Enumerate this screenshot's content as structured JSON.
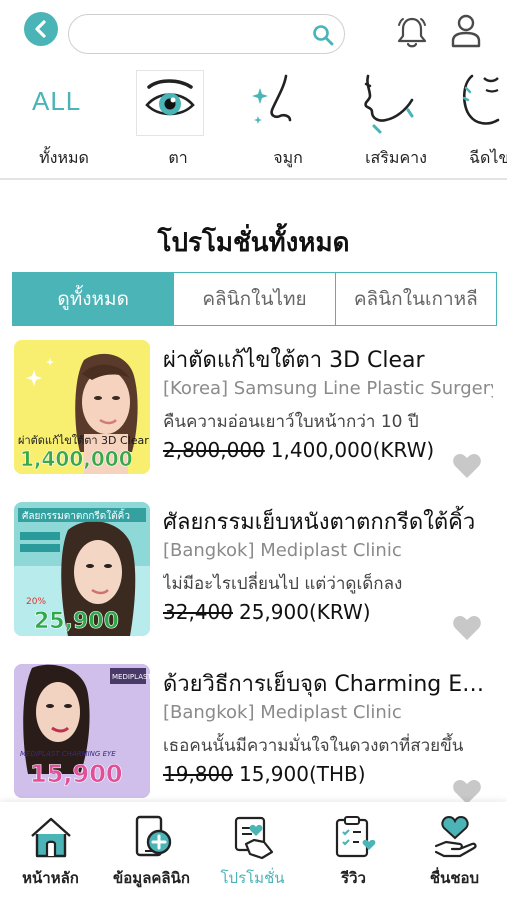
{
  "header": {
    "search_placeholder": "",
    "search_value": ""
  },
  "categories": [
    {
      "label": "ทั้งหมด",
      "icon": "all-text",
      "text": "ALL"
    },
    {
      "label": "ตา",
      "icon": "eye-icon"
    },
    {
      "label": "จมูก",
      "icon": "nose-icon"
    },
    {
      "label": "เสริมคาง",
      "icon": "chin-icon"
    },
    {
      "label": "ฉีดไขมัน",
      "icon": "face-fat-icon"
    }
  ],
  "section_title": "โปรโมชั่นทั้งหมด",
  "tabs": [
    {
      "label": "ดูทั้งหมด",
      "active": true
    },
    {
      "label": "คลินิกในไทย",
      "active": false
    },
    {
      "label": "คลินิกในเกาหลี",
      "active": false
    }
  ],
  "promotions": [
    {
      "title": "ผ่าตัดแก้ไขใต้ตา 3D Clear",
      "clinic": "[Korea] Samsung Line Plastic Surgery",
      "desc": "คืนความอ่อนเยาว์ใบหน้ากว่า 10 ปี",
      "old_price": "2,800,000",
      "new_price": "1,400,000(KRW)",
      "thumb_text": "ผ่าตัดแก้ไขใต้ตา 3D Clear",
      "thumb_price": "1,400,000",
      "thumb_bg": "#f6ec4c"
    },
    {
      "title": "ศัลยกรรมเย็บหนังตาตกกรีดใต้คิ้ว",
      "clinic": "[Bangkok] Mediplast Clinic",
      "desc": "ไม่มีอะไรเปลี่ยนไป แต่ว่าดูเด็กลง",
      "old_price": "32,400",
      "new_price": "25,900(KRW)",
      "thumb_text": "ศัลยกรรมตาตกกรีดใต้คิ้ว",
      "thumb_price": "25,900",
      "thumb_bg": "#8fd8d8"
    },
    {
      "title": "ด้วยวิธีการเย็บจุด Charming Eyes",
      "clinic": "[Bangkok] Mediplast Clinic",
      "desc": "เธอคนนั้นมีความมั่นใจในดวงตาที่สวยขึ้น",
      "old_price": "19,800",
      "new_price": "15,900(THB)",
      "thumb_text": "MEDIPLAST CHARMING EYE",
      "thumb_price": "15,900",
      "thumb_bg": "#b9a6e0"
    }
  ],
  "bottom_nav": [
    {
      "label": "หน้าหลัก",
      "icon": "home-icon",
      "active": false
    },
    {
      "label": "ข้อมูลคลินิก",
      "icon": "clinic-info-icon",
      "active": false
    },
    {
      "label": "โปรโมชั่น",
      "icon": "promotion-icon",
      "active": true
    },
    {
      "label": "รีวิว",
      "icon": "review-icon",
      "active": false
    },
    {
      "label": "ชื่นชอบ",
      "icon": "favorite-icon",
      "active": false
    }
  ],
  "colors": {
    "accent": "#4ab4b6",
    "heart": "#c8c8c8"
  }
}
